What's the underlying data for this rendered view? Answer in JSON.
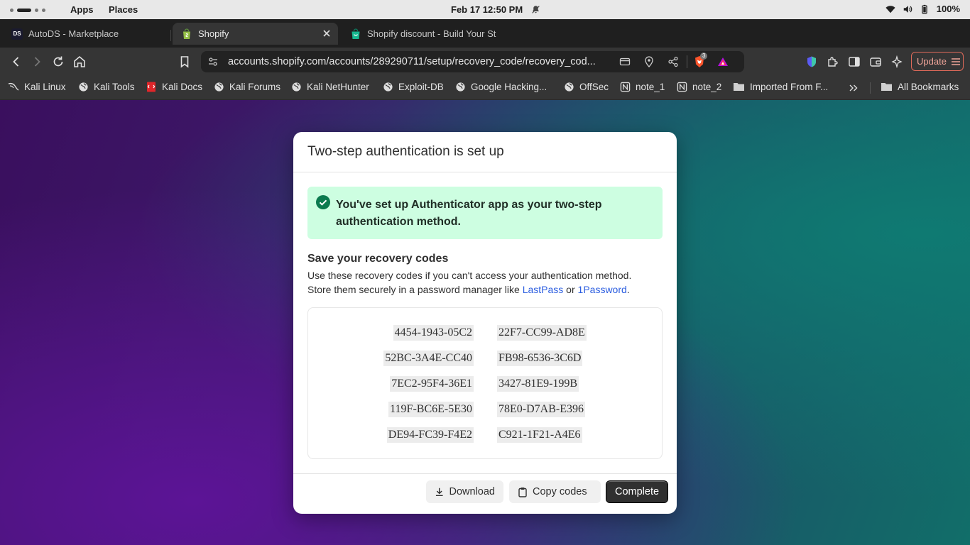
{
  "topbar": {
    "apps": "Apps",
    "places": "Places",
    "clock": "Feb 17  12:50 PM",
    "battery": "100%"
  },
  "tabs": [
    {
      "title": "AutoDS - Marketplace",
      "favicon_text": "DS",
      "favicon_color": "#1a1a2e"
    },
    {
      "title": "Shopify",
      "favicon_color": "#95bf47"
    },
    {
      "title": "Shopify discount - Build Your St",
      "favicon_color": "#95bf47"
    }
  ],
  "toolbar": {
    "url": "accounts.shopify.com/accounts/289290711/setup/recovery_code/recovery_cod...",
    "shield_count": "3",
    "update_label": "Update"
  },
  "bookmarks": [
    {
      "label": "Kali Linux",
      "icon": "kali-dragon-icon"
    },
    {
      "label": "Kali Tools",
      "icon": "globe-icon"
    },
    {
      "label": "Kali Docs",
      "icon": "kali-docs-icon"
    },
    {
      "label": "Kali Forums",
      "icon": "globe-icon"
    },
    {
      "label": "Kali NetHunter",
      "icon": "globe-icon"
    },
    {
      "label": "Exploit-DB",
      "icon": "globe-icon"
    },
    {
      "label": "Google Hacking...",
      "icon": "globe-icon"
    },
    {
      "label": "OffSec",
      "icon": "globe-icon"
    },
    {
      "label": "note_1",
      "icon": "notion-icon"
    },
    {
      "label": "note_2",
      "icon": "notion-icon"
    },
    {
      "label": "Imported From F...",
      "icon": "folder-icon"
    },
    {
      "label": "All Bookmarks",
      "icon": "folder-icon"
    }
  ],
  "modal": {
    "title": "Two-step authentication is set up",
    "banner": "You've set up Authenticator app as your two-step authentication method.",
    "save_heading": "Save your recovery codes",
    "desc_line1": "Use these recovery codes if you can't access your authentication method.",
    "desc_line2_prefix": "Store them securely in a password manager like ",
    "link_lastpass": "LastPass",
    "desc_or": " or ",
    "link_1password": "1Password",
    "desc_end": ".",
    "codes_left": [
      "4454-1943-05C2",
      "52BC-3A4E-CC40",
      "7EC2-95F4-36E1",
      "119F-BC6E-5E30",
      "DE94-FC39-F4E2"
    ],
    "codes_right": [
      "22F7-CC99-AD8E",
      "FB98-6536-3C6D",
      "3427-81E9-199B",
      "78E0-D7AB-E396",
      "C921-1F21-A4E6"
    ],
    "download_label": "Download",
    "copy_label": "Copy codes",
    "complete_label": "Complete"
  }
}
